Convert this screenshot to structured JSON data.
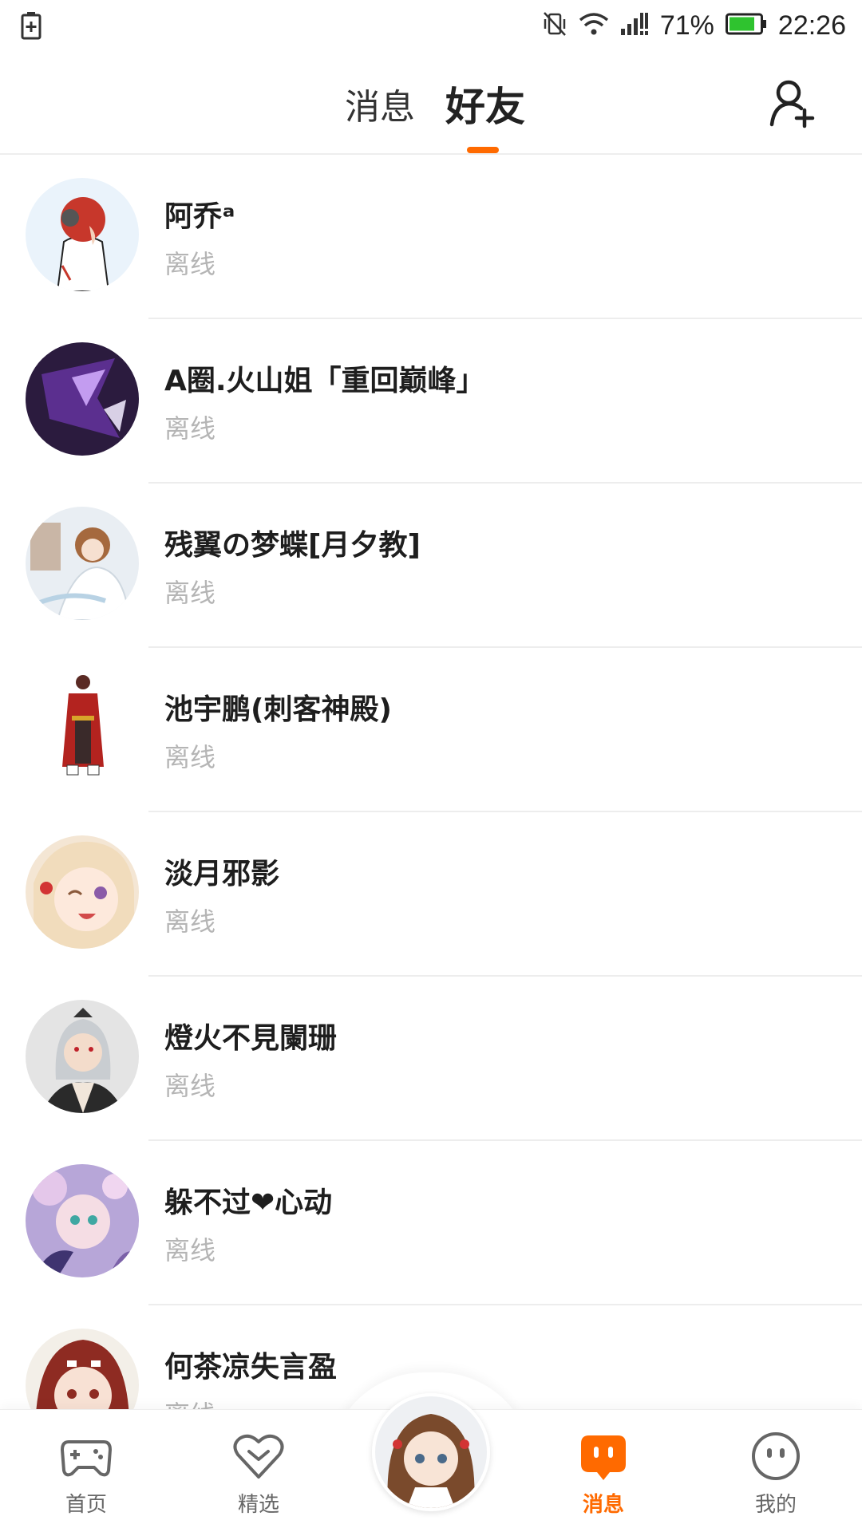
{
  "status_bar": {
    "battery_percent": "71%",
    "time": "22:26"
  },
  "header": {
    "tabs": [
      {
        "label": "消息"
      },
      {
        "label": "好友"
      }
    ]
  },
  "friends": [
    {
      "name": "阿乔ᵃ",
      "status": "离线"
    },
    {
      "name": "A圈.火山姐「重回巅峰」",
      "status": "离线"
    },
    {
      "name": "残翼の梦蝶[月夕教]",
      "status": "离线"
    },
    {
      "name": "池宇鹏(刺客神殿)",
      "status": "离线"
    },
    {
      "name": "淡月邪影",
      "status": "离线"
    },
    {
      "name": "燈火不見闌珊",
      "status": "离线"
    },
    {
      "name": "躲不过❤心动",
      "status": "离线"
    },
    {
      "name": "何茶凉失言盈",
      "status": "离线"
    }
  ],
  "bottom_nav": {
    "items": [
      {
        "label": "首页",
        "icon": "gamepad-icon"
      },
      {
        "label": "精选",
        "icon": "heart-chevron-icon"
      },
      {
        "label": "消息",
        "icon": "chat-bubble-icon"
      },
      {
        "label": "我的",
        "icon": "face-icon"
      }
    ]
  },
  "colors": {
    "accent": "#ff6a00",
    "offline_text": "#b5b5b5",
    "battery_green": "#2fc32f"
  }
}
